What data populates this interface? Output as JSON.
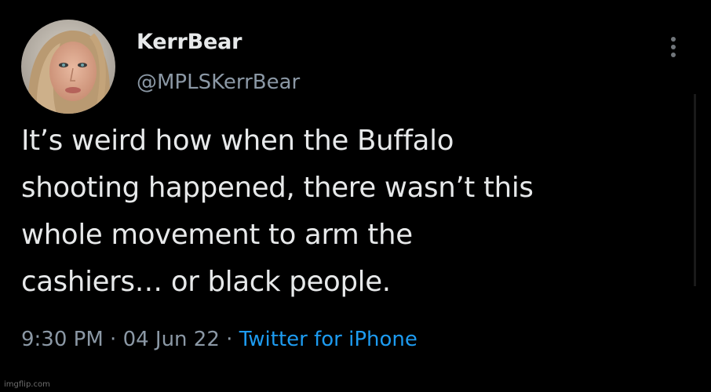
{
  "author": {
    "display_name": "KerrBear",
    "handle": "@MPLSKerrBear"
  },
  "tweet": {
    "lines": [
      "It’s weird how when the Buffalo",
      "shooting happened, there wasn’t this",
      "whole movement to arm the",
      "cashiers… or black people."
    ]
  },
  "meta": {
    "time": "9:30 PM",
    "separator": " · ",
    "date": "04 Jun 22",
    "source": "Twitter for iPhone"
  },
  "icons": {
    "more": "more-vertical-icon"
  },
  "watermark": "imgflip.com",
  "colors": {
    "background": "#000000",
    "text": "#e7e9ea",
    "secondary": "#8b98a5",
    "link": "#1d9bf0"
  }
}
